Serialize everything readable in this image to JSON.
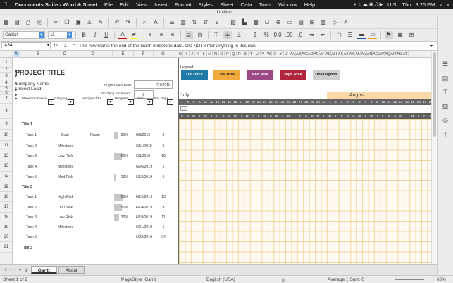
{
  "menubar": {
    "apple": "",
    "app": "Documents Suite - Word & Sheet",
    "items": [
      "File",
      "Edit",
      "View",
      "Insert",
      "Format",
      "Styles",
      "Sheet",
      "Data",
      "Tools",
      "Window",
      "Help"
    ],
    "flag": "U.S.",
    "day": "Thu",
    "time": "9:26 PM"
  },
  "window": {
    "title": "Untitled 1"
  },
  "toolbar": {
    "font": "Calibri",
    "size": "11"
  },
  "formula": {
    "namebox": "A34",
    "fx": "f×",
    "sum": "Σ",
    "eq": "=",
    "text": "This row marks the end of the Gantt milestone data. DO NOT enter anything in this row."
  },
  "columns": [
    "A",
    "B",
    "C",
    "D",
    "E",
    "F",
    "G"
  ],
  "gantt_columns": [
    "H",
    "I",
    "J",
    "K",
    "L",
    "M",
    "N",
    "O",
    "P",
    "Q",
    "R",
    "S",
    "T",
    "U",
    "V",
    "W",
    "X",
    "Y",
    "Z",
    "AA",
    "AB",
    "AC",
    "AD",
    "AE",
    "AF",
    "AG",
    "AH",
    "AI",
    "AJ",
    "AK",
    "AL",
    "AM",
    "AN",
    "AO",
    "AP",
    "AQ",
    "AR",
    "AS",
    "AT"
  ],
  "rows": [
    "1",
    "2",
    "3",
    "4",
    "5",
    "6",
    "7",
    "8",
    "9",
    "10",
    "11",
    "12",
    "13",
    "14",
    "15",
    "16",
    "17",
    "18",
    "19",
    "20",
    "21"
  ],
  "sheet": {
    "project_title": "PROJECT TITLE",
    "company": "Company Name",
    "lead": "Project Lead",
    "start_label": "Project Start Date:",
    "start_value": "7/7/2018",
    "scroll_label": "Scrolling Increment:",
    "scroll_value": "0",
    "headers": {
      "milestone": "Milestone Description",
      "category": "Category",
      "assigned": "Assigned To",
      "progress": "Progress",
      "start": "Start",
      "days": "No. Days"
    },
    "dd": "▾",
    "rows": [
      {
        "name": "Title 1",
        "category": "",
        "assigned": "",
        "progress": "",
        "start": "",
        "days": ""
      },
      {
        "name": "Task 1",
        "category": "Goal",
        "assigned": "Name",
        "progress": "25%",
        "start": "6/6/2019",
        "days": "3"
      },
      {
        "name": "Task 2",
        "category": "Milestone",
        "assigned": "",
        "progress": "",
        "start": "6/11/2019",
        "days": "5"
      },
      {
        "name": "Task 3",
        "category": "Low Risk",
        "assigned": "",
        "progress": "50%",
        "start": "6/3/2019",
        "days": "10"
      },
      {
        "name": "Task 4",
        "category": "Milestone",
        "assigned": "",
        "progress": "",
        "start": "6/26/2019",
        "days": "1"
      },
      {
        "name": "Task 5",
        "category": "Med Risk",
        "assigned": "",
        "progress": "10%",
        "start": "6/12/2019",
        "days": "6"
      },
      {
        "name": "Title 2",
        "category": "",
        "assigned": "",
        "progress": "",
        "start": "",
        "days": ""
      },
      {
        "name": "Task 1",
        "category": "High Risk",
        "assigned": "",
        "progress": "60%",
        "start": "6/12/2019",
        "days": "13"
      },
      {
        "name": "Task 2",
        "category": "On Track",
        "assigned": "",
        "progress": "50%",
        "start": "6/14/2019",
        "days": "9"
      },
      {
        "name": "Task 3",
        "category": "Low Risk",
        "assigned": "",
        "progress": "30%",
        "start": "6/19/2019",
        "days": "11"
      },
      {
        "name": "Task 4",
        "category": "Milestone",
        "assigned": "",
        "progress": "",
        "start": "6/21/2019",
        "days": "1"
      },
      {
        "name": "Task 5",
        "category": "",
        "assigned": "",
        "progress": "",
        "start": "6/22/2019",
        "days": "24"
      },
      {
        "name": "Title 3",
        "category": "",
        "assigned": "",
        "progress": "",
        "start": "",
        "days": ""
      }
    ],
    "progress_values": [
      0,
      0.25,
      0,
      0.5,
      0,
      0.1,
      0,
      0.6,
      0.5,
      0.3,
      0,
      0,
      0
    ]
  },
  "gantt": {
    "legend_label": "Legend:",
    "legend": [
      {
        "label": "On Track",
        "color": "#1f7aa8"
      },
      {
        "label": "Low Risk",
        "color": "#f2a93b"
      },
      {
        "label": "Med Risk",
        "color": "#9b4a86"
      },
      {
        "label": "High Risk",
        "color": "#b0243e"
      },
      {
        "label": "Unassigned",
        "color": "#cfcfcf"
      }
    ],
    "months": [
      "July",
      "August"
    ],
    "dates": [
      "7",
      "8",
      "9",
      "10",
      "11",
      "12",
      "13",
      "14",
      "15",
      "16",
      "17",
      "18",
      "19",
      "20",
      "21",
      "22",
      "23",
      "24",
      "25",
      "26",
      "27",
      "28",
      "29",
      "30",
      "31",
      "1",
      "2",
      "3",
      "4",
      "5",
      "6",
      "7",
      "8",
      "9",
      "10",
      "11",
      "12",
      "13",
      "14",
      "15",
      "16",
      "17",
      "18"
    ],
    "weekdays": [
      "S",
      "S",
      "M",
      "T",
      "W",
      "T",
      "F",
      "S",
      "S",
      "M",
      "T",
      "W",
      "T",
      "F",
      "S",
      "S",
      "M",
      "T",
      "W",
      "T",
      "F",
      "S",
      "S",
      "M",
      "T",
      "W",
      "T",
      "F",
      "S",
      "S",
      "M",
      "T",
      "W",
      "T",
      "F",
      "S",
      "S",
      "M",
      "T",
      "W",
      "T",
      "F",
      "S"
    ]
  },
  "tabs": [
    "Gantt",
    "About"
  ],
  "tab_buttons": [
    "‹",
    "›",
    "«",
    "»",
    "+"
  ],
  "status": {
    "sheet": "Sheet 1 of 2",
    "style": "PageStyle_Gantt",
    "lang": "English (USA)",
    "calc": "Average: ; Sum: 0",
    "zoom": "60%"
  }
}
